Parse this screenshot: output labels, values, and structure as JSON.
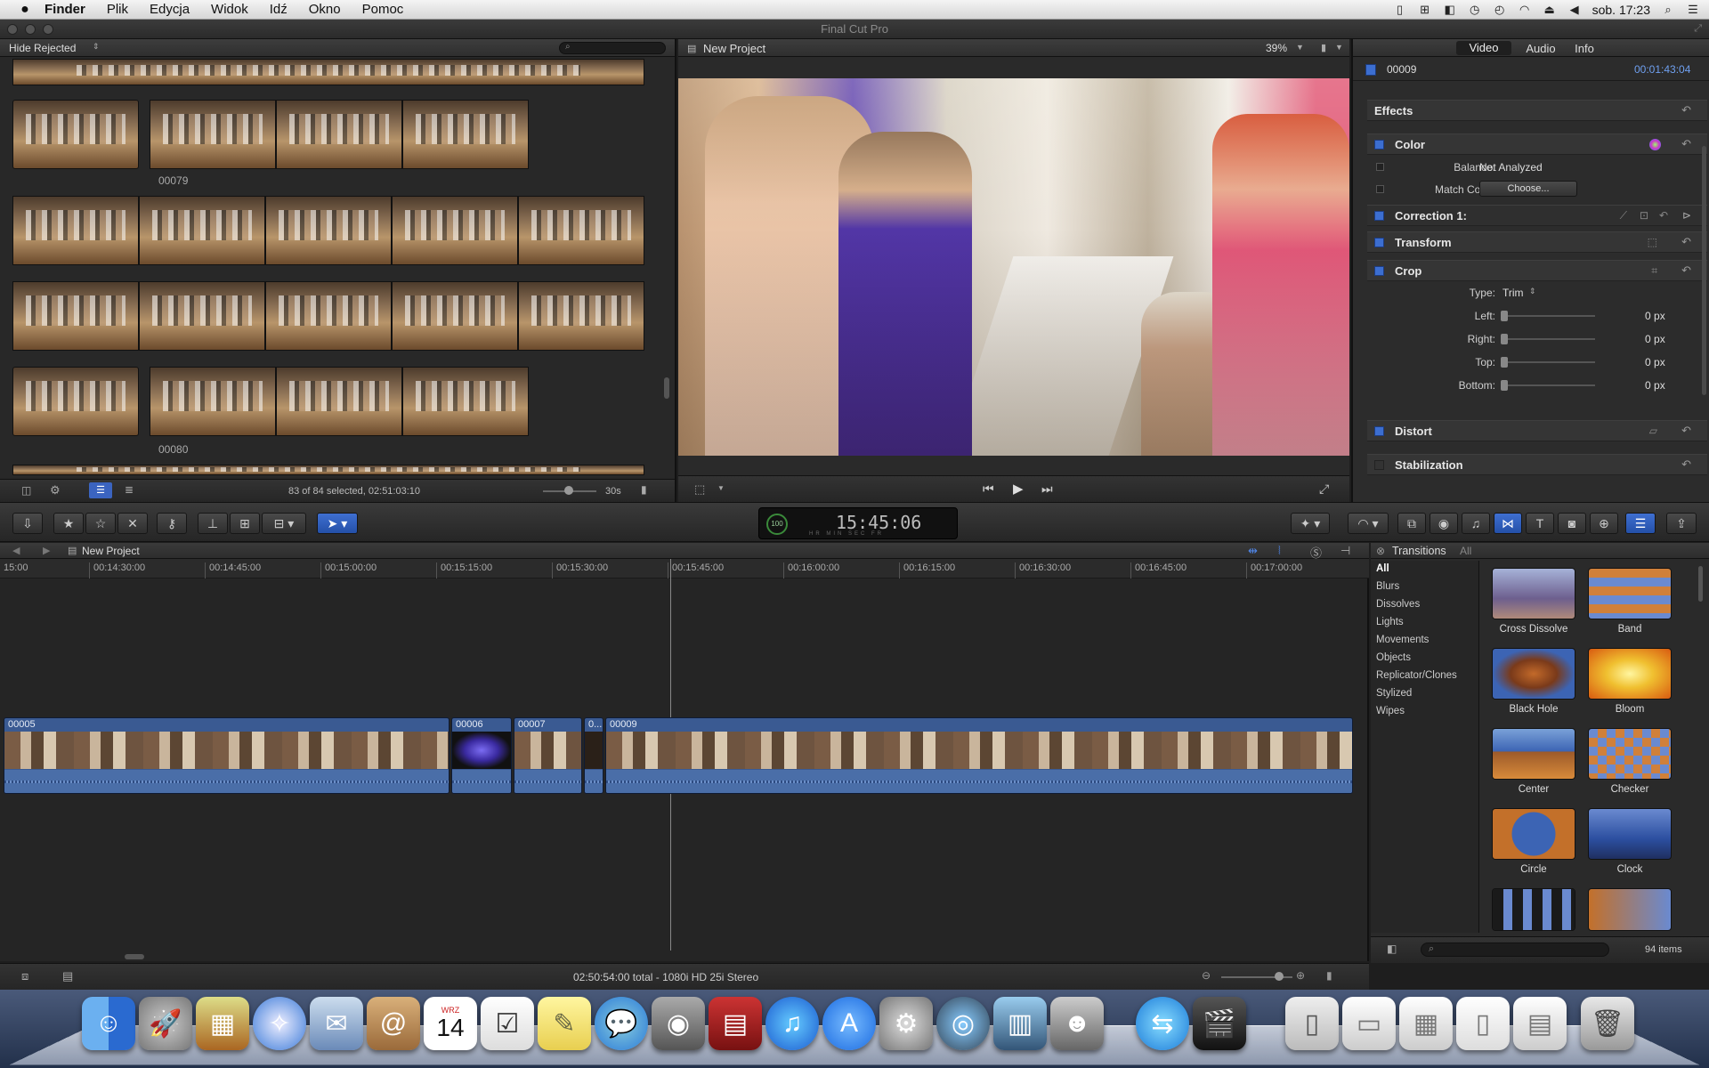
{
  "menubar": {
    "apple": "",
    "items": [
      "Finder",
      "Plik",
      "Edycja",
      "Widok",
      "Idź",
      "Okno",
      "Pomoc"
    ],
    "clock": "sob. 17:23"
  },
  "window": {
    "title": "Final Cut Pro"
  },
  "browser": {
    "filter": "Hide Rejected",
    "search_placeholder": "",
    "clip_labels": [
      "00079",
      "00080"
    ],
    "status": "83 of 84 selected, 02:51:03:10",
    "zoom_label": "30s"
  },
  "viewer": {
    "title": "New Project",
    "zoom": "39%"
  },
  "inspector": {
    "tabs": [
      "Video",
      "Audio",
      "Info"
    ],
    "clip_name": "00009",
    "duration": "00:01:43:04",
    "effects_label": "Effects",
    "color": {
      "label": "Color",
      "balance_label": "Balance:",
      "balance_value": "Not Analyzed",
      "match_label": "Match Color:",
      "match_button": "Choose...",
      "correction_label": "Correction 1:"
    },
    "transform_label": "Transform",
    "crop": {
      "label": "Crop",
      "type_label": "Type:",
      "type_value": "Trim",
      "rows": [
        {
          "label": "Left:",
          "value": "0",
          "unit": "px"
        },
        {
          "label": "Right:",
          "value": "0",
          "unit": "px"
        },
        {
          "label": "Top:",
          "value": "0",
          "unit": "px"
        },
        {
          "label": "Bottom:",
          "value": "0",
          "unit": "px"
        }
      ]
    },
    "distort_label": "Distort",
    "stabilization_label": "Stabilization"
  },
  "toolbar": {
    "timecode": "15:45:06",
    "ring_value": "100",
    "units": "HR MIN SEC FR"
  },
  "timeline": {
    "project": "New Project",
    "ruler": [
      "15:00",
      "00:14:30:00",
      "00:14:45:00",
      "00:15:00:00",
      "00:15:15:00",
      "00:15:30:00",
      "00:15:45:00",
      "00:16:00:00",
      "00:16:15:00",
      "00:16:30:00",
      "00:16:45:00",
      "00:17:00:00"
    ],
    "clips": [
      "00005",
      "00006",
      "00007",
      "0...",
      "00009"
    ],
    "status": "02:50:54:00 total - 1080i HD 25i Stereo"
  },
  "transitions": {
    "title": "Transitions",
    "scope": "All",
    "categories": [
      "All",
      "Blurs",
      "Dissolves",
      "Lights",
      "Movements",
      "Objects",
      "Replicator/Clones",
      "Stylized",
      "Wipes"
    ],
    "items": [
      "Cross Dissolve",
      "Band",
      "Black Hole",
      "Bloom",
      "Center",
      "Checker",
      "Circle",
      "Clock"
    ],
    "count": "94 items"
  },
  "dock": {
    "calendar_month": "WRZ",
    "calendar_day": "14"
  }
}
